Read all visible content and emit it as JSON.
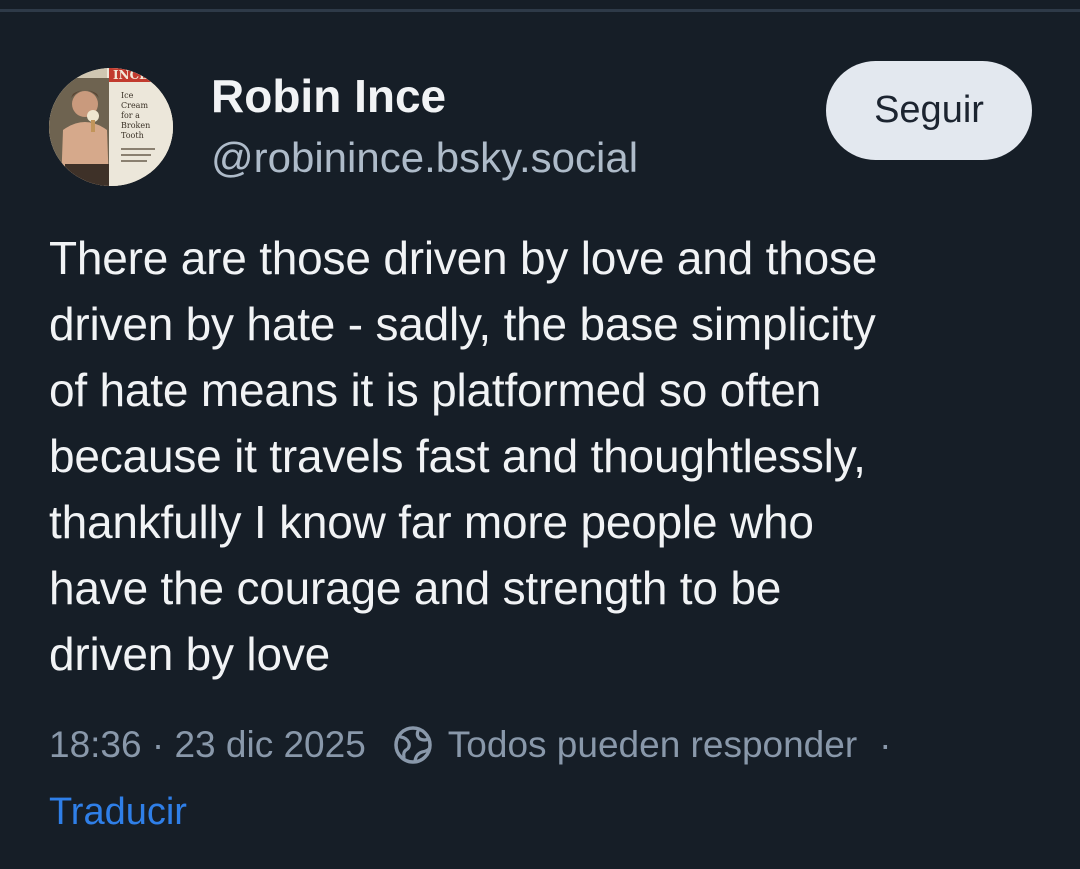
{
  "author": {
    "display_name": "Robin Ince",
    "handle": "@robinince.bsky.social",
    "avatar_text": [
      "Ice",
      "Cream",
      "for a",
      "Broken",
      "Tooth"
    ]
  },
  "follow_button": {
    "label": "Seguir"
  },
  "post": {
    "lines": [
      "There are those driven by love and those",
      "driven by hate - sadly, the base simplicity",
      "of hate means it is platformed so often",
      "because it travels fast and thoughtlessly,",
      "thankfully I know far more people who",
      "have the courage and strength to be",
      "driven by love"
    ]
  },
  "meta": {
    "timestamp": "18:36 · 23 dic 2025",
    "reply_setting": "Todos pueden responder",
    "separator": "·"
  },
  "translate": {
    "label": "Traducir"
  },
  "colors": {
    "background": "#161e27",
    "text_primary": "#f1f3f5",
    "text_secondary": "#aebbc9",
    "meta": "#8998aa",
    "link": "#2f7fe8",
    "button_bg": "#e3e8ef"
  },
  "icons": {
    "reply_setting": "globe-icon"
  }
}
